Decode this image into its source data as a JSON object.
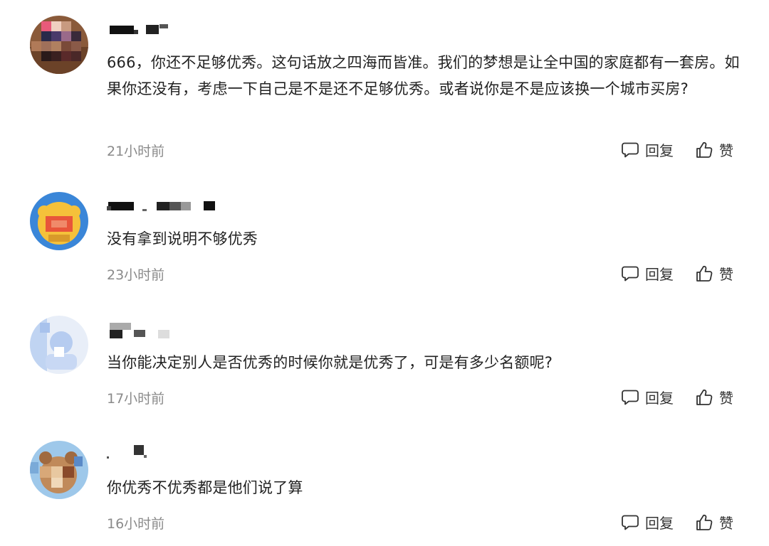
{
  "comments": [
    {
      "avatar_icon": "user-avatar-icon",
      "text": "666，你还不足够优秀。这句话放之四海而皆准。我们的梦想是让全中国的家庭都有一套房。如果你还没有，考虑一下自己是不是还不足够优秀。或者说你是不是应该换一个城市买房?",
      "time": "21小时前",
      "reply_label": "回复",
      "like_label": "赞"
    },
    {
      "avatar_icon": "user-avatar-icon",
      "text": "没有拿到说明不够优秀",
      "time": "23小时前",
      "reply_label": "回复",
      "like_label": "赞"
    },
    {
      "avatar_icon": "user-avatar-icon",
      "text": "当你能决定别人是否优秀的时候你就是优秀了，可是有多少名额呢?",
      "time": "17小时前",
      "reply_label": "回复",
      "like_label": "赞"
    },
    {
      "avatar_icon": "user-avatar-icon",
      "text": "你优秀不优秀都是他们说了算",
      "time": "16小时前",
      "reply_label": "回复",
      "like_label": "赞"
    }
  ],
  "icons": {
    "reply": "comment-bubble-icon",
    "like": "thumbs-up-icon"
  },
  "colors": {
    "text": "#222222",
    "meta": "#8a8a8a",
    "action": "#333333"
  }
}
